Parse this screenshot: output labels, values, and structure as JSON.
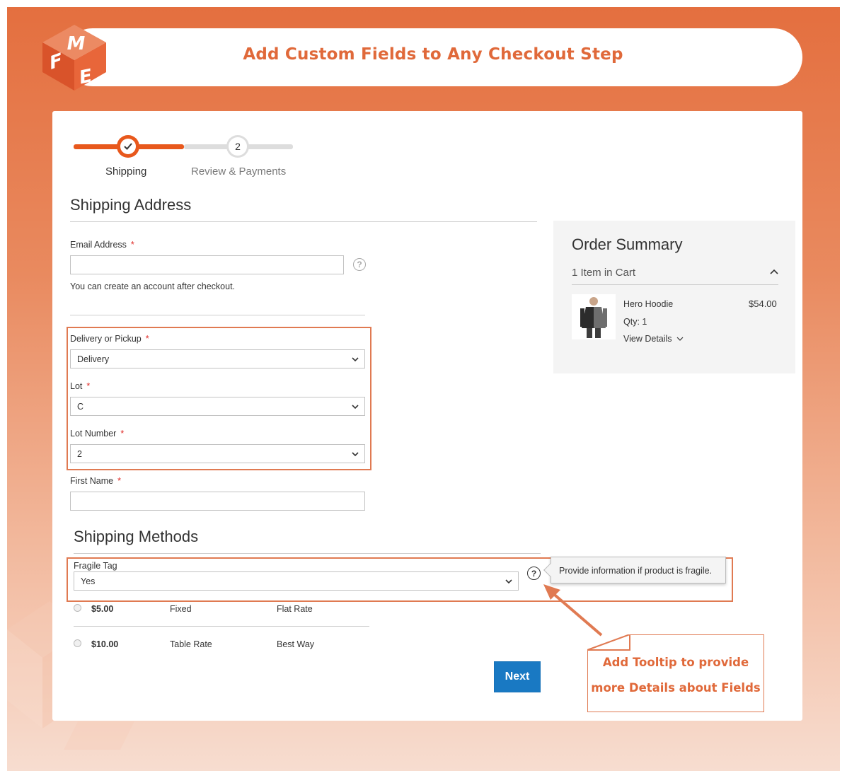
{
  "banner": {
    "title": "Add Custom Fields to Any Checkout Step"
  },
  "logo": {
    "letters": "FME"
  },
  "progress": {
    "steps": [
      {
        "label": "Shipping",
        "state": "done"
      },
      {
        "label": "Review & Payments",
        "number": "2",
        "state": "pending"
      }
    ]
  },
  "shipping_address": {
    "title": "Shipping Address",
    "email": {
      "label": "Email Address",
      "value": "",
      "required": "*"
    },
    "email_note": "You can create an account after checkout.",
    "delivery": {
      "label": "Delivery or Pickup",
      "value": "Delivery",
      "required": "*"
    },
    "lot": {
      "label": "Lot",
      "value": "C",
      "required": "*"
    },
    "lot_number": {
      "label": "Lot Number",
      "value": "2",
      "required": "*"
    },
    "first_name": {
      "label": "First Name",
      "value": "",
      "required": "*"
    }
  },
  "shipping_methods": {
    "title": "Shipping Methods",
    "fragile": {
      "label": "Fragile Tag",
      "value": "Yes",
      "tooltip": "Provide information if product is fragile."
    },
    "rates": [
      {
        "price": "$5.00",
        "method": "Fixed",
        "carrier": "Flat Rate"
      },
      {
        "price": "$10.00",
        "method": "Table Rate",
        "carrier": "Best Way"
      }
    ],
    "next_label": "Next"
  },
  "order_summary": {
    "title": "Order Summary",
    "count": "1 Item in Cart",
    "item": {
      "name": "Hero Hoodie",
      "price": "$54.00",
      "qty": "Qty: 1",
      "details": "View Details"
    }
  },
  "callout": {
    "line1": "Add Tooltip to provide",
    "line2": "more Details about Fields"
  },
  "colors": {
    "brand": "#e46f3f",
    "accent": "#e8581c",
    "button": "#1979c3",
    "highlight": "#e07a52"
  }
}
